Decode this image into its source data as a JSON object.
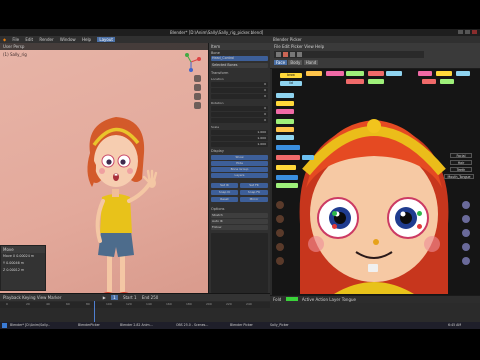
{
  "app": {
    "title": "Blender* [D:\\Anim\\Sally\\Sally_rig_picker.blend]",
    "menus": [
      "File",
      "Edit",
      "Render",
      "Window",
      "Help"
    ],
    "workspace_tab": "Layout"
  },
  "viewport": {
    "mode_label": "User Persp",
    "object_label": "(1) Sally_rig",
    "operator_panel": {
      "title": "Move",
      "fields": [
        {
          "label": "Move X",
          "value": "0.00024 m"
        },
        {
          "label": "Y",
          "value": "0.00046 m"
        },
        {
          "label": "Z",
          "value": "0.00012 m"
        }
      ]
    }
  },
  "properties": {
    "header": "Item",
    "sections": [
      {
        "title": "Bone",
        "rows": [
          "Head_Control",
          "Selected Bones"
        ]
      },
      {
        "title": "Transform",
        "rows": [
          "Location",
          "0",
          "0",
          "0",
          "Rotation",
          "0",
          "0",
          "0",
          "Scale",
          "1.000",
          "1.000",
          "1.000"
        ]
      },
      {
        "title": "Display",
        "rows": [
          "Show",
          "Hide",
          "Bone Group",
          "Layers"
        ]
      }
    ],
    "tools": [
      "Set IK",
      "Set FK",
      "Snap IK",
      "Snap FK",
      "Reset",
      "Mirror"
    ],
    "options_title": "Options",
    "options_rows": [
      "Stretch",
      "Auto IK",
      "Follow"
    ]
  },
  "picker": {
    "window_title": "Blender Picker",
    "menus": [
      "File",
      "Edit",
      "Picker",
      "View",
      "Help"
    ],
    "tabs": [
      "Face",
      "Body",
      "Hand"
    ],
    "side_buttons": [
      "Facial",
      "Hair",
      "Teeth",
      "Mouth_Tongue"
    ],
    "footer_label": "Active Action Layer",
    "footer_value": "Tongue",
    "footer_field": "Fold"
  },
  "timeline": {
    "menus": [
      "Playback",
      "Keying",
      "View",
      "Marker"
    ],
    "current_frame": "1",
    "start": "Start 1",
    "end": "End 250",
    "ruler": [
      "0",
      "20",
      "40",
      "60",
      "80",
      "100",
      "120",
      "140",
      "160",
      "180",
      "200",
      "220",
      "240"
    ]
  },
  "taskbar": {
    "items": [
      "Blender* [D:\\Anim\\Sally...",
      "BlenderPicker",
      "Blender 2.82 Anim...",
      "OBS 25.0 - Scenes...",
      "Blender Picker",
      "Sally_Picker"
    ],
    "clock": "6:45 AM"
  }
}
